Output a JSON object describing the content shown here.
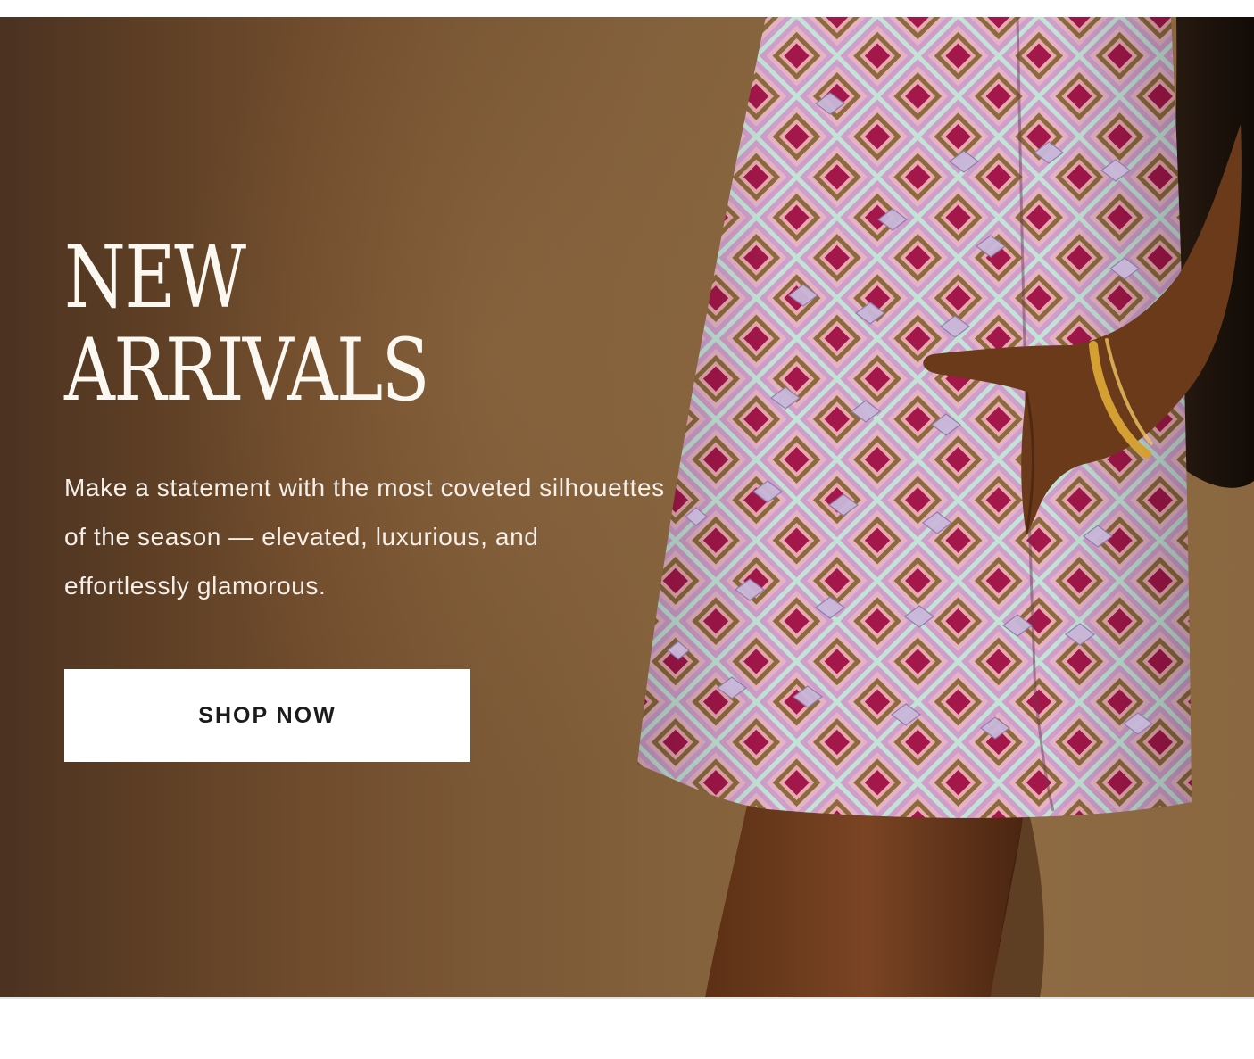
{
  "hero": {
    "headline_line1": "NEW",
    "headline_line2": "ARRIVALS",
    "description": "Make a statement with the most coveted silhouettes of the season — elevated, luxurious, and effortlessly glamorous.",
    "cta_label": "SHOP NOW"
  },
  "colors": {
    "background_brown": "#7a5735",
    "text_light": "#fbf7f1",
    "button_bg": "#ffffff",
    "button_text": "#1b1b1b",
    "dress_lilac": "#d8a7cf",
    "dress_magenta": "#a8174a",
    "dress_mint": "#bfe0d4",
    "dress_olive": "#8a6a3a"
  }
}
